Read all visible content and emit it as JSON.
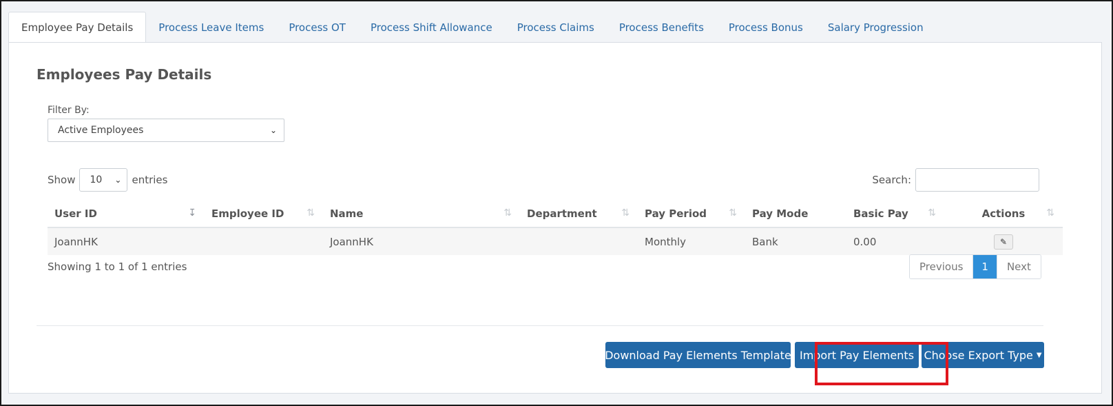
{
  "tabs": [
    {
      "label": "Employee Pay Details",
      "active": true
    },
    {
      "label": "Process Leave Items",
      "active": false
    },
    {
      "label": "Process OT",
      "active": false
    },
    {
      "label": "Process Shift Allowance",
      "active": false
    },
    {
      "label": "Process Claims",
      "active": false
    },
    {
      "label": "Process Benefits",
      "active": false
    },
    {
      "label": "Process Bonus",
      "active": false
    },
    {
      "label": "Salary Progression",
      "active": false
    }
  ],
  "page_title": "Employees Pay Details",
  "filter": {
    "label": "Filter By:",
    "value": "Active Employees"
  },
  "length_menu": {
    "before": "Show",
    "value": "10",
    "after": "entries"
  },
  "search": {
    "label": "Search:",
    "value": ""
  },
  "table": {
    "columns": [
      "User ID",
      "Employee ID",
      "Name",
      "Department",
      "Pay Period",
      "Pay Mode",
      "Basic Pay",
      "Actions"
    ],
    "rows": [
      {
        "user_id": "JoannHK",
        "employee_id": "",
        "name": "JoannHK",
        "department": "",
        "pay_period": "Monthly",
        "pay_mode": "Bank",
        "basic_pay": "0.00",
        "action_icon": "pencil-icon"
      }
    ]
  },
  "info": "Showing 1 to 1 of 1 entries",
  "pagination": {
    "previous": "Previous",
    "current": "1",
    "next": "Next"
  },
  "buttons": {
    "download_template": "Download Pay Elements Template",
    "import": "Import Pay Elements",
    "export": "Choose Export Type"
  },
  "colors": {
    "primary_button": "#2268a7",
    "tab_link": "#2a6aa6",
    "page_active": "#2f8fd8",
    "highlight": "#e0161d"
  }
}
